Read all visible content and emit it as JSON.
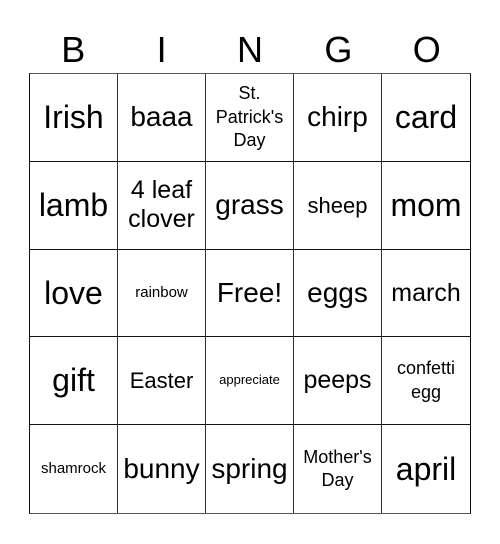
{
  "card": {
    "header": [
      "B",
      "I",
      "N",
      "G",
      "O"
    ],
    "rows": [
      [
        {
          "text": "Irish",
          "size": "xl"
        },
        {
          "text": "baaa",
          "size": "lg"
        },
        {
          "text": "St. Patrick's Day",
          "size": "xs"
        },
        {
          "text": "chirp",
          "size": "lg"
        },
        {
          "text": "card",
          "size": "xl"
        }
      ],
      [
        {
          "text": "lamb",
          "size": "xl"
        },
        {
          "text": "4 leaf clover",
          "size": "md"
        },
        {
          "text": "grass",
          "size": "lg"
        },
        {
          "text": "sheep",
          "size": "sm"
        },
        {
          "text": "mom",
          "size": "xl"
        }
      ],
      [
        {
          "text": "love",
          "size": "xl"
        },
        {
          "text": "rainbow",
          "size": "xxs"
        },
        {
          "text": "Free!",
          "size": "lg"
        },
        {
          "text": "eggs",
          "size": "lg"
        },
        {
          "text": "march",
          "size": "md"
        }
      ],
      [
        {
          "text": "gift",
          "size": "xl"
        },
        {
          "text": "Easter",
          "size": "sm"
        },
        {
          "text": "appreciate",
          "size": "tiny"
        },
        {
          "text": "peeps",
          "size": "md"
        },
        {
          "text": "confetti egg",
          "size": "xs"
        }
      ],
      [
        {
          "text": "shamrock",
          "size": "xxs"
        },
        {
          "text": "bunny",
          "size": "lg"
        },
        {
          "text": "spring",
          "size": "lg"
        },
        {
          "text": "Mother's Day",
          "size": "xs"
        },
        {
          "text": "april",
          "size": "xl"
        }
      ]
    ]
  }
}
